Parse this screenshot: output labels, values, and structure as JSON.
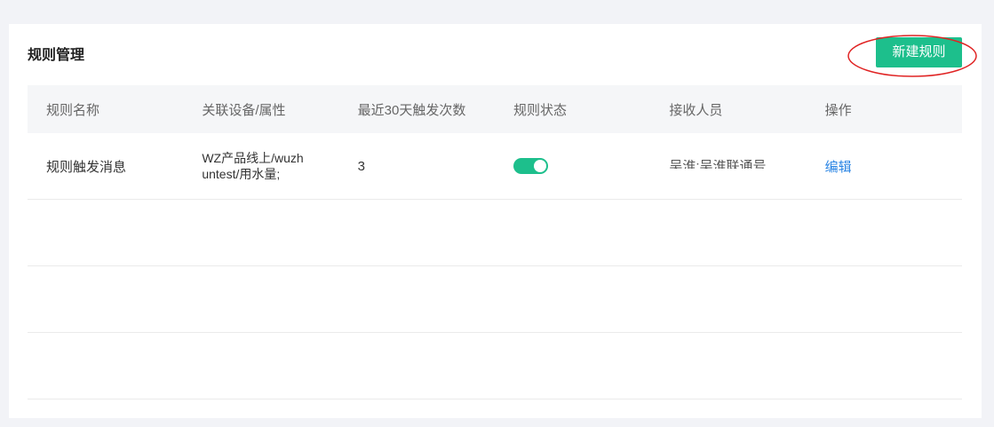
{
  "page": {
    "title": "规则管理"
  },
  "toolbar": {
    "new_rule_label": "新建规则"
  },
  "table": {
    "columns": [
      "规则名称",
      "关联设备/属性",
      "最近30天触发次数",
      "规则状态",
      "接收人员",
      "操作"
    ],
    "rows": [
      {
        "name": "规则触发消息",
        "device_lines": [
          "WZ产品线上/wuzh",
          "untest/用水量;"
        ],
        "trigger_count": "3",
        "status_on": true,
        "recipients": "吴淮:吴淮联通号",
        "action_label": "编辑"
      }
    ]
  },
  "colors": {
    "accent": "#1dbf8c",
    "link": "#2b85e4",
    "annotation": "#e02424"
  }
}
